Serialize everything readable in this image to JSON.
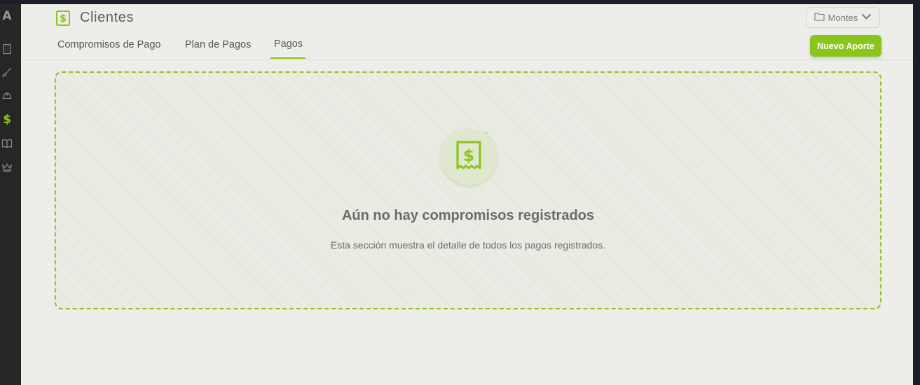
{
  "sidebar": {
    "logo": "A",
    "dollar": "$",
    "items": [
      {
        "icon": "building-icon"
      },
      {
        "icon": "brush-icon"
      },
      {
        "icon": "hardhat-icon"
      },
      {
        "icon": "dollar-icon"
      },
      {
        "icon": "book-icon"
      },
      {
        "icon": "crown-icon"
      }
    ]
  },
  "header": {
    "title": "Clientes",
    "title_icon": "receipt-dollar-icon",
    "folder_label": "Montes",
    "new_button": "Nuevo Aporte"
  },
  "tabs": [
    {
      "label": "Compromisos de Pago",
      "active": false
    },
    {
      "label": "Plan de Pagos",
      "active": false
    },
    {
      "label": "Pagos",
      "active": true
    }
  ],
  "empty_state": {
    "icon": "receipt-dollar-icon",
    "title": "Aún no hay compromisos registrados",
    "description": "Esta sección muestra el detalle de todos los pagos registrados."
  },
  "colors": {
    "accent": "#8fc31f",
    "sidebar_bg": "#262626",
    "panel_bg": "#ededea"
  }
}
